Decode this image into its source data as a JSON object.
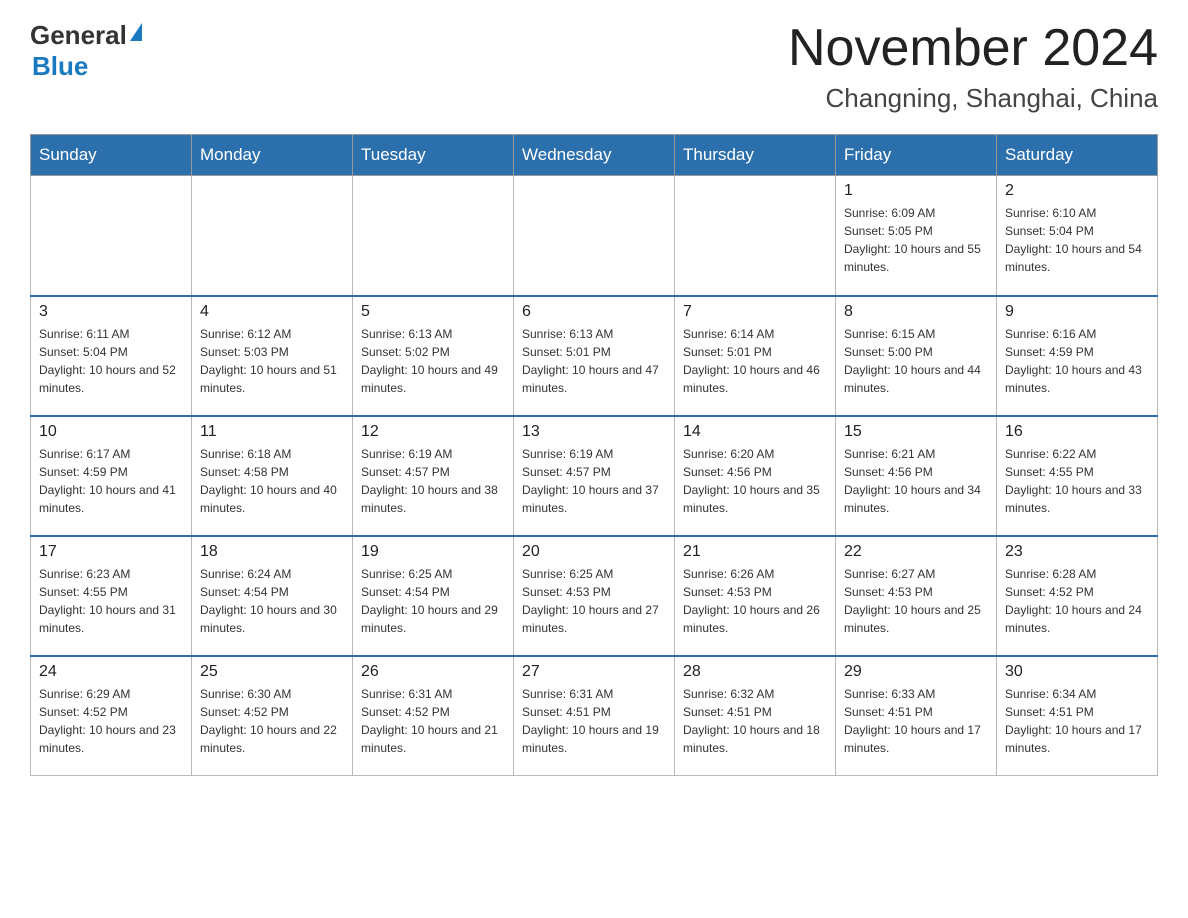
{
  "header": {
    "logo_general": "General",
    "logo_blue": "Blue",
    "month_title": "November 2024",
    "location": "Changning, Shanghai, China"
  },
  "days_of_week": [
    "Sunday",
    "Monday",
    "Tuesday",
    "Wednesday",
    "Thursday",
    "Friday",
    "Saturday"
  ],
  "weeks": [
    [
      {
        "day": "",
        "info": ""
      },
      {
        "day": "",
        "info": ""
      },
      {
        "day": "",
        "info": ""
      },
      {
        "day": "",
        "info": ""
      },
      {
        "day": "",
        "info": ""
      },
      {
        "day": "1",
        "info": "Sunrise: 6:09 AM\nSunset: 5:05 PM\nDaylight: 10 hours and 55 minutes."
      },
      {
        "day": "2",
        "info": "Sunrise: 6:10 AM\nSunset: 5:04 PM\nDaylight: 10 hours and 54 minutes."
      }
    ],
    [
      {
        "day": "3",
        "info": "Sunrise: 6:11 AM\nSunset: 5:04 PM\nDaylight: 10 hours and 52 minutes."
      },
      {
        "day": "4",
        "info": "Sunrise: 6:12 AM\nSunset: 5:03 PM\nDaylight: 10 hours and 51 minutes."
      },
      {
        "day": "5",
        "info": "Sunrise: 6:13 AM\nSunset: 5:02 PM\nDaylight: 10 hours and 49 minutes."
      },
      {
        "day": "6",
        "info": "Sunrise: 6:13 AM\nSunset: 5:01 PM\nDaylight: 10 hours and 47 minutes."
      },
      {
        "day": "7",
        "info": "Sunrise: 6:14 AM\nSunset: 5:01 PM\nDaylight: 10 hours and 46 minutes."
      },
      {
        "day": "8",
        "info": "Sunrise: 6:15 AM\nSunset: 5:00 PM\nDaylight: 10 hours and 44 minutes."
      },
      {
        "day": "9",
        "info": "Sunrise: 6:16 AM\nSunset: 4:59 PM\nDaylight: 10 hours and 43 minutes."
      }
    ],
    [
      {
        "day": "10",
        "info": "Sunrise: 6:17 AM\nSunset: 4:59 PM\nDaylight: 10 hours and 41 minutes."
      },
      {
        "day": "11",
        "info": "Sunrise: 6:18 AM\nSunset: 4:58 PM\nDaylight: 10 hours and 40 minutes."
      },
      {
        "day": "12",
        "info": "Sunrise: 6:19 AM\nSunset: 4:57 PM\nDaylight: 10 hours and 38 minutes."
      },
      {
        "day": "13",
        "info": "Sunrise: 6:19 AM\nSunset: 4:57 PM\nDaylight: 10 hours and 37 minutes."
      },
      {
        "day": "14",
        "info": "Sunrise: 6:20 AM\nSunset: 4:56 PM\nDaylight: 10 hours and 35 minutes."
      },
      {
        "day": "15",
        "info": "Sunrise: 6:21 AM\nSunset: 4:56 PM\nDaylight: 10 hours and 34 minutes."
      },
      {
        "day": "16",
        "info": "Sunrise: 6:22 AM\nSunset: 4:55 PM\nDaylight: 10 hours and 33 minutes."
      }
    ],
    [
      {
        "day": "17",
        "info": "Sunrise: 6:23 AM\nSunset: 4:55 PM\nDaylight: 10 hours and 31 minutes."
      },
      {
        "day": "18",
        "info": "Sunrise: 6:24 AM\nSunset: 4:54 PM\nDaylight: 10 hours and 30 minutes."
      },
      {
        "day": "19",
        "info": "Sunrise: 6:25 AM\nSunset: 4:54 PM\nDaylight: 10 hours and 29 minutes."
      },
      {
        "day": "20",
        "info": "Sunrise: 6:25 AM\nSunset: 4:53 PM\nDaylight: 10 hours and 27 minutes."
      },
      {
        "day": "21",
        "info": "Sunrise: 6:26 AM\nSunset: 4:53 PM\nDaylight: 10 hours and 26 minutes."
      },
      {
        "day": "22",
        "info": "Sunrise: 6:27 AM\nSunset: 4:53 PM\nDaylight: 10 hours and 25 minutes."
      },
      {
        "day": "23",
        "info": "Sunrise: 6:28 AM\nSunset: 4:52 PM\nDaylight: 10 hours and 24 minutes."
      }
    ],
    [
      {
        "day": "24",
        "info": "Sunrise: 6:29 AM\nSunset: 4:52 PM\nDaylight: 10 hours and 23 minutes."
      },
      {
        "day": "25",
        "info": "Sunrise: 6:30 AM\nSunset: 4:52 PM\nDaylight: 10 hours and 22 minutes."
      },
      {
        "day": "26",
        "info": "Sunrise: 6:31 AM\nSunset: 4:52 PM\nDaylight: 10 hours and 21 minutes."
      },
      {
        "day": "27",
        "info": "Sunrise: 6:31 AM\nSunset: 4:51 PM\nDaylight: 10 hours and 19 minutes."
      },
      {
        "day": "28",
        "info": "Sunrise: 6:32 AM\nSunset: 4:51 PM\nDaylight: 10 hours and 18 minutes."
      },
      {
        "day": "29",
        "info": "Sunrise: 6:33 AM\nSunset: 4:51 PM\nDaylight: 10 hours and 17 minutes."
      },
      {
        "day": "30",
        "info": "Sunrise: 6:34 AM\nSunset: 4:51 PM\nDaylight: 10 hours and 17 minutes."
      }
    ]
  ]
}
